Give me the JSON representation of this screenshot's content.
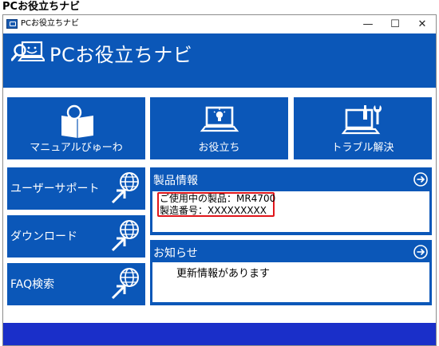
{
  "caption": "PCお役立ちナビ",
  "window": {
    "title": "PCお役立ちナビ",
    "minimize": "—",
    "maximize": "☐",
    "close": "✕"
  },
  "header": {
    "title": "PCお役立ちナビ"
  },
  "tiles": {
    "manual": "マニュアルびゅーわ",
    "tips": "お役立ち",
    "trouble": "トラブル解決"
  },
  "side": {
    "user_support": "ユーザーサポート",
    "download": "ダウンロード",
    "faq": "FAQ検索"
  },
  "product_panel": {
    "title": "製品情報",
    "model_line": "ご使用中の製品：MR4700",
    "serial_line": "製造番号：XXXXXXXXX"
  },
  "news_panel": {
    "title": "お知らせ",
    "message": "更新情報があります"
  },
  "colors": {
    "tile_blue": "#0b57b8",
    "footer_blue": "#1a2fc9",
    "highlight_red": "#e0161b"
  }
}
